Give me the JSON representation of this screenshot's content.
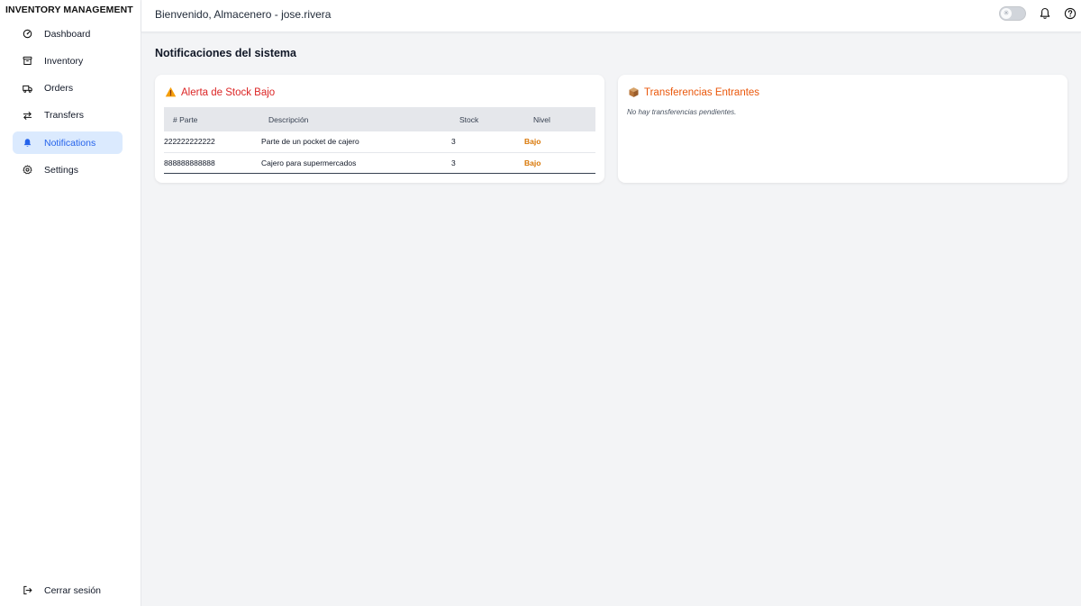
{
  "app": {
    "title": "INVENTORY MANAGEMENT"
  },
  "sidebar": {
    "items": [
      {
        "label": "Dashboard",
        "icon": "dashboard-icon"
      },
      {
        "label": "Inventory",
        "icon": "archive-box-icon"
      },
      {
        "label": "Orders",
        "icon": "truck-icon"
      },
      {
        "label": "Transfers",
        "icon": "arrows-exchange-icon"
      },
      {
        "label": "Notifications",
        "icon": "bell-icon",
        "active": true
      },
      {
        "label": "Settings",
        "icon": "gear-icon"
      }
    ],
    "logout_label": "Cerrar sesión"
  },
  "topbar": {
    "welcome": "Bienvenido, Almacenero - jose.rivera",
    "theme_toggle_icon": "sun-icon",
    "notifications_icon": "bell-icon",
    "help_icon": "question-circle-icon"
  },
  "page": {
    "title": "Notificaciones del sistema"
  },
  "low_stock": {
    "title": "Alerta de Stock Bajo",
    "icon": "warning-triangle-icon",
    "columns": [
      "# Parte",
      "Descripción",
      "Stock",
      "Nivel"
    ],
    "rows": [
      {
        "part": "222222222222",
        "description": "Parte de un pocket de cajero",
        "stock": "3",
        "level": "Bajo"
      },
      {
        "part": "888888888888",
        "description": "Cajero para supermercados",
        "stock": "3",
        "level": "Bajo"
      }
    ]
  },
  "transfers": {
    "title": "Transferencias Entrantes",
    "icon": "package-icon",
    "empty_message": "No hay transferencias pendientes."
  },
  "colors": {
    "active_nav_bg": "#dbeafe",
    "active_nav_text": "#2563eb",
    "alert_red": "#dc2626",
    "transfer_orange": "#ea580c",
    "level_low": "#d97706"
  }
}
